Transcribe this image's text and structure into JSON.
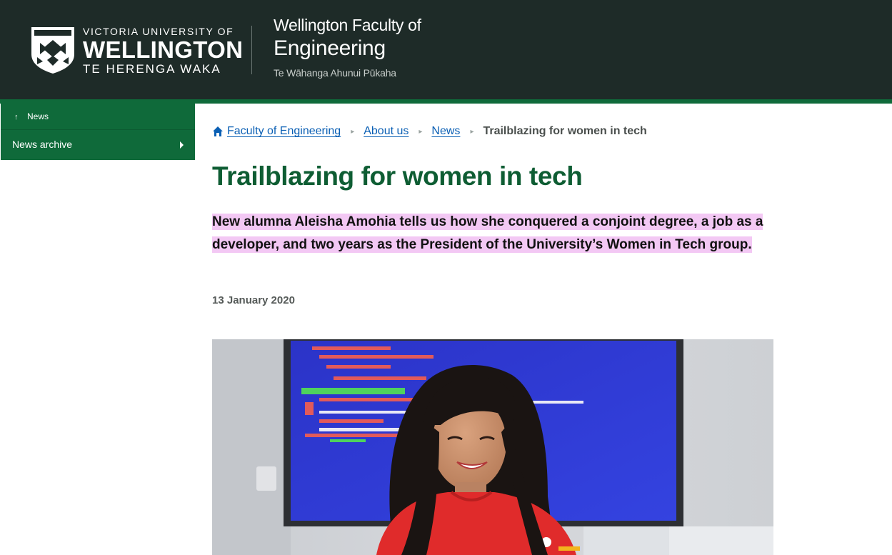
{
  "header": {
    "university": {
      "line_top": "VICTORIA UNIVERSITY OF",
      "line_main": "WELLINGTON",
      "line_sub": "TE HERENGA WAKA"
    },
    "faculty": {
      "line1": "Wellington Faculty of",
      "line2": "Engineering",
      "maori_name": "Te Wāhanga Ahunui Pūkaha"
    },
    "logo_icon": "university-crest-icon"
  },
  "sidenav": {
    "up_link": {
      "icon": "up-arrow-icon",
      "label": "News"
    },
    "items": [
      {
        "label": "News archive",
        "icon": "caret-right-icon"
      }
    ]
  },
  "breadcrumb": {
    "home_icon": "home-icon",
    "items": [
      {
        "label": "Faculty of Engineering"
      },
      {
        "label": "About us"
      },
      {
        "label": "News"
      },
      {
        "label": "Trailblazing for women in tech"
      }
    ],
    "separator": "▸"
  },
  "article": {
    "title": "Trailblazing for women in tech",
    "intro": "New alumna Aleisha Amohia tells us how she conquered a conjoint degree, a job as a developer, and two years as the President of the University’s Women in Tech group.",
    "date": "13 January 2020"
  },
  "colors": {
    "header_bg": "#1e2b28",
    "brand_green": "#0f6a3a",
    "title_green": "#0e5d33",
    "link_blue": "#0a5fb4",
    "intro_highlight": "#f3c8f4"
  }
}
